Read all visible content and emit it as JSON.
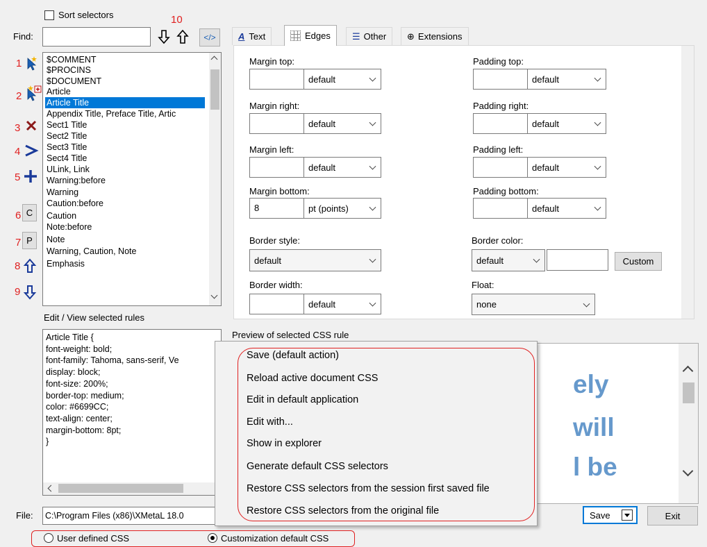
{
  "top": {
    "sort_label": "Sort selectors",
    "find_label": "Find:",
    "find_value": "",
    "code_btn": "</>"
  },
  "annotations": [
    "1",
    "2",
    "3",
    "4",
    "5",
    "6",
    "7",
    "8",
    "9",
    "10"
  ],
  "side_buttons": {
    "c": "C",
    "p": "P"
  },
  "selectors": [
    "$COMMENT",
    "$PROCINS",
    "$DOCUMENT",
    "Article",
    "Article Title",
    "Appendix Title, Preface Title, Artic",
    "Sect1 Title",
    "Sect2 Title",
    "Sect3 Title",
    "Sect4 Title",
    "ULink, Link",
    "Warning:before",
    "Warning",
    "Caution:before",
    "Caution",
    "Note:before",
    "Note",
    "Warning, Caution, Note",
    "Emphasis"
  ],
  "tabs": [
    "Text",
    "Edges",
    "Other",
    "Extensions"
  ],
  "edges": {
    "margin_top": {
      "label": "Margin top:",
      "value": "",
      "unit": "default"
    },
    "margin_right": {
      "label": "Margin right:",
      "value": "",
      "unit": "default"
    },
    "margin_left": {
      "label": "Margin left:",
      "value": "",
      "unit": "default"
    },
    "margin_bottom": {
      "label": "Margin bottom:",
      "value": "8",
      "unit": "pt (points)"
    },
    "padding_top": {
      "label": "Padding top:",
      "value": "",
      "unit": "default"
    },
    "padding_right": {
      "label": "Padding right:",
      "value": "",
      "unit": "default"
    },
    "padding_left": {
      "label": "Padding left:",
      "value": "",
      "unit": "default"
    },
    "padding_bottom": {
      "label": "Padding bottom:",
      "value": "",
      "unit": "default"
    },
    "border_style": {
      "label": "Border style:",
      "value": "default"
    },
    "border_color": {
      "label": "Border color:",
      "value": "default",
      "custom": "Custom"
    },
    "border_width": {
      "label": "Border width:",
      "value": "",
      "unit": "default"
    },
    "float": {
      "label": "Float:",
      "value": "none"
    }
  },
  "editor": {
    "label": "Edit / View selected rules",
    "lines": [
      "Article Title {",
      " font-weight: bold;",
      " font-family: Tahoma, sans-serif, Ve",
      " display: block;",
      " font-size: 200%;",
      " border-top: medium;",
      " color: #6699CC;",
      " text-align: center;",
      " margin-bottom: 8pt;",
      "}"
    ]
  },
  "preview": {
    "label": "Preview of selected CSS rule",
    "fragments": [
      "ely",
      "will",
      "l be"
    ],
    "color": "#6699CC"
  },
  "menu": [
    "Save (default action)",
    "Reload active document CSS",
    "Edit in default application",
    "Edit with...",
    "Show in explorer",
    "Generate default CSS selectors",
    "Restore CSS selectors from the session first saved file",
    "Restore CSS selectors from the original file"
  ],
  "bottom": {
    "file_label": "File:",
    "file_value": "C:\\Program Files (x86)\\XMetaL 18.0",
    "save": "Save",
    "exit": "Exit",
    "radio_user": "User defined CSS",
    "radio_default": "Customization default CSS"
  },
  "colors": {
    "accent": "#0078d7",
    "annotation": "#e02020",
    "preview_text": "#6699CC"
  }
}
